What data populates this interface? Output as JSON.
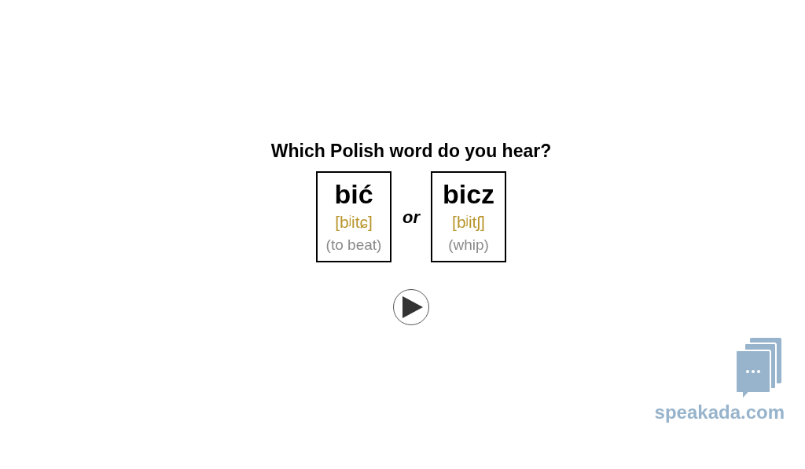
{
  "question": "Which Polish word do you hear?",
  "options": [
    {
      "word": "bić",
      "ipa": "[bʲitɕ]",
      "meaning": "(to beat)"
    },
    {
      "word": "bicz",
      "ipa": "[bʲitʃ]",
      "meaning": "(whip)"
    }
  ],
  "separator": "or",
  "logo": {
    "text": "speakada.com"
  }
}
